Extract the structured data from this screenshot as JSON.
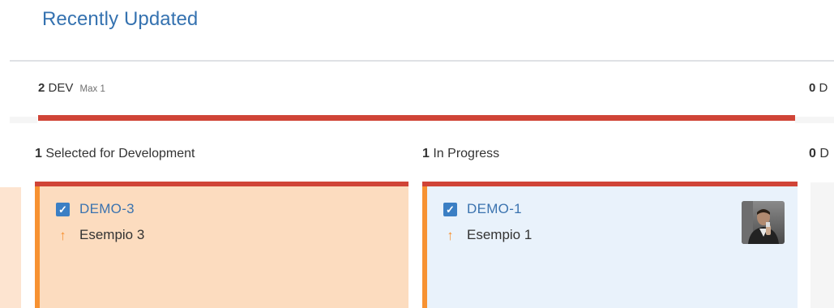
{
  "section": {
    "title": "Recently Updated"
  },
  "swimlane": {
    "count": "2",
    "name": "DEV",
    "max": "Max 1"
  },
  "right_header": {
    "count": "0",
    "name": "D"
  },
  "columns": [
    {
      "count": "1",
      "name": "Selected for Development"
    },
    {
      "count": "1",
      "name": "In Progress"
    },
    {
      "count": "0",
      "name": "D"
    }
  ],
  "cards": [
    {
      "key": "DEMO-3",
      "summary": "Esempio 3",
      "priority": "↑",
      "checkbox": "✓",
      "has_avatar": false
    },
    {
      "key": "DEMO-1",
      "summary": "Esempio 1",
      "priority": "↑",
      "checkbox": "✓",
      "has_avatar": true
    }
  ],
  "colors": {
    "link": "#3572b0",
    "limit_bar": "#d04437",
    "card_border": "#f79232",
    "card1_bg": "#fcdcbf",
    "card2_bg": "#e9f2fb",
    "checkbox": "#3b7fc4"
  },
  "icons": {
    "checkbox": "checkbox-icon",
    "priority": "priority-high-icon"
  }
}
